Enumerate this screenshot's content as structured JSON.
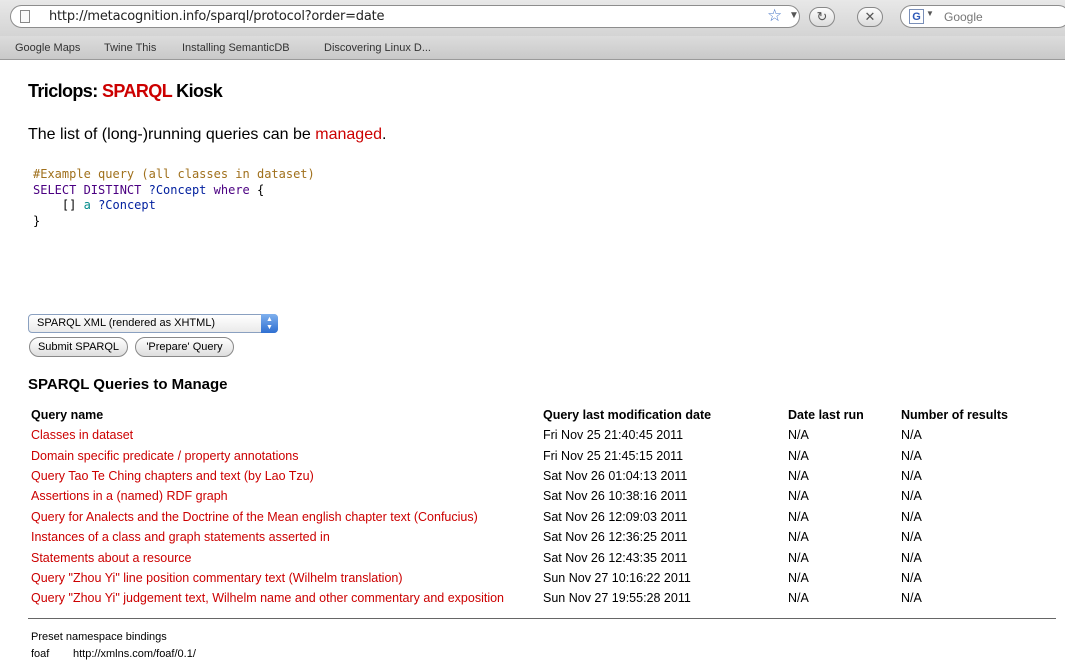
{
  "browser": {
    "url": "http://metacognition.info/sparql/protocol?order=date",
    "search_placeholder": "Google",
    "bookmarks": [
      "Google Maps",
      "Twine This",
      "Installing SemanticDB",
      "Discovering Linux D..."
    ]
  },
  "page": {
    "title_prefix": "Triclops: ",
    "title_accent": "SPARQL",
    "title_suffix": " Kiosk",
    "intro_text": "The list of (long-)running queries can be ",
    "intro_link": "managed",
    "intro_end": ".",
    "code": {
      "comment": "#Example query (all classes in dataset)",
      "select_kw": "SELECT DISTINCT",
      "concept_var": "?Concept",
      "where_kw": "where",
      "open_brace": "{",
      "bracket": "[]",
      "a_kw": "a",
      "close_brace": "}"
    },
    "format_select": "SPARQL XML (rendered as XHTML)",
    "submit_button": "Submit SPARQL",
    "prepare_button": "'Prepare' Query",
    "manage_heading": "SPARQL Queries to Manage",
    "table": {
      "headers": [
        "Query name",
        "Query last modification date",
        "Date last run",
        "Number of results"
      ],
      "rows": [
        {
          "name": "Classes in dataset",
          "modified": "Fri Nov 25 21:40:45 2011",
          "last_run": "N/A",
          "results": "N/A"
        },
        {
          "name": "Domain specific predicate / property annotations",
          "modified": "Fri Nov 25 21:45:15 2011",
          "last_run": "N/A",
          "results": "N/A"
        },
        {
          "name": "Query Tao Te Ching chapters and text (by Lao Tzu)",
          "modified": "Sat Nov 26 01:04:13 2011",
          "last_run": "N/A",
          "results": "N/A"
        },
        {
          "name": "Assertions in a (named) RDF graph",
          "modified": "Sat Nov 26 10:38:16 2011",
          "last_run": "N/A",
          "results": "N/A"
        },
        {
          "name": "Query for Analects and the Doctrine of the Mean english chapter text (Confucius)",
          "modified": "Sat Nov 26 12:09:03 2011",
          "last_run": "N/A",
          "results": "N/A"
        },
        {
          "name": "Instances of a class and graph statements asserted in",
          "modified": "Sat Nov 26 12:36:25 2011",
          "last_run": "N/A",
          "results": "N/A"
        },
        {
          "name": "Statements about a resource",
          "modified": "Sat Nov 26 12:43:35 2011",
          "last_run": "N/A",
          "results": "N/A"
        },
        {
          "name": "Query \"Zhou Yi\" line position commentary text (Wilhelm translation)",
          "modified": "Sun Nov 27 10:16:22 2011",
          "last_run": "N/A",
          "results": "N/A"
        },
        {
          "name": "Query \"Zhou Yi\" judgement text, Wilhelm name and other commentary and exposition",
          "modified": "Sun Nov 27 19:55:28 2011",
          "last_run": "N/A",
          "results": "N/A"
        }
      ]
    },
    "namespace_heading": "Preset namespace bindings",
    "namespaces": [
      {
        "prefix": "foaf",
        "uri": "http://xmlns.com/foaf/0.1/"
      }
    ]
  }
}
